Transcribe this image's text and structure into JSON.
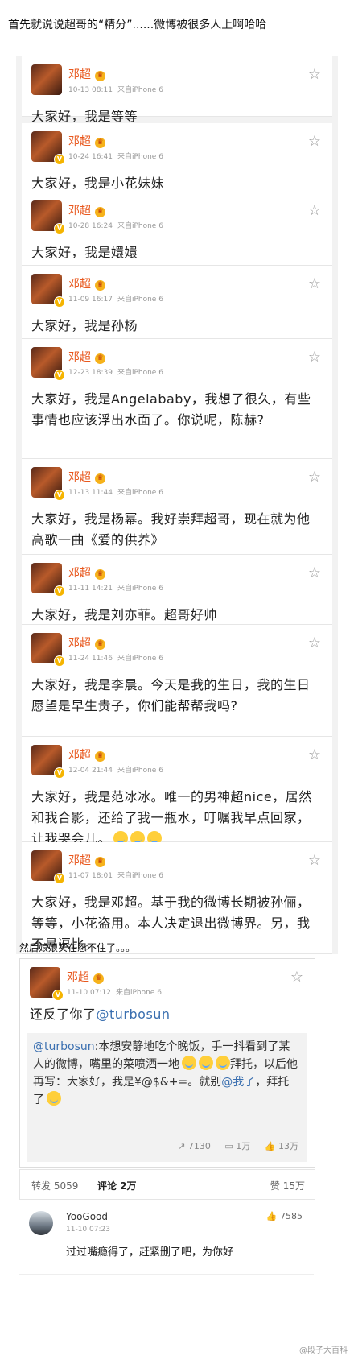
{
  "caption": "首先就说说超哥的“精分”......微博被很多人上啊哈哈",
  "posts": [
    {
      "name": "邓超",
      "date": "10-13 08:11",
      "source": "来自iPhone 6",
      "text": "大家好，我是等等"
    },
    {
      "name": "邓超",
      "date": "10-24 16:41",
      "source": "来自iPhone 6",
      "text": "大家好，我是小花妹妹"
    },
    {
      "name": "邓超",
      "date": "10-28 16:24",
      "source": "来自iPhone 6",
      "text": "大家好，我是嬛嬛"
    },
    {
      "name": "邓超",
      "date": "11-09 16:17",
      "source": "来自iPhone 6",
      "text": "大家好，我是孙杨"
    },
    {
      "name": "邓超",
      "date": "12-23 18:39",
      "source": "来自iPhone 6",
      "text": "大家好，我是Angelababy，我想了很久，有些事情也应该浮出水面了。你说呢，陈赫?"
    },
    {
      "name": "邓超",
      "date": "11-13 11:44",
      "source": "来自iPhone 6",
      "text": "大家好，我是杨幂。我好崇拜超哥，现在就为他高歌一曲《爱的供养》"
    },
    {
      "name": "邓超",
      "date": "11-11 14:21",
      "source": "来自iPhone 6",
      "text": "大家好，我是刘亦菲。超哥好帅"
    },
    {
      "name": "邓超",
      "date": "11-24 11:46",
      "source": "来自iPhone 6",
      "text": "大家好，我是李晨。今天是我的生日，我的生日愿望是早生贵子，你们能帮帮我吗?"
    },
    {
      "name": "邓超",
      "date": "12-04 21:44",
      "source": "来自iPhone 6",
      "text": "大家好，我是范冰冰。唯一的男神超nice，居然和我合影，还给了我一瓶水，叮嘱我早点回家，让我哭会儿。"
    },
    {
      "name": "邓超",
      "date": "11-07 18:01",
      "source": "来自iPhone 6",
      "text": "大家好，我是邓超。基于我的微博长期被孙俪，等等，小花盗用。本人决定退出微博界。另，我不是逗比。"
    }
  ],
  "section2_label": "然后娘娘实在忍不住了。。。",
  "repost": {
    "name": "邓超",
    "date": "11-10 07:12",
    "source": "来自iPhone 6",
    "text_prefix": "还反了你了",
    "mention": "@turbosun",
    "quote_mention": "@turbosun",
    "quote_text": ":本想安静地吃个晚饭，手一抖看到了某人的微博，嘴里的菜喷洒一地",
    "quote_text2": "拜托，以后他再写：大家好，我是¥@$&+=。就别",
    "quote_mention2": "@我了",
    "quote_text3": "，拜托了",
    "repost_count": "7130",
    "comment_count": "1万",
    "like_count": "13万"
  },
  "stats": {
    "reposts": "转发 5059",
    "comments": "评论 2万",
    "likes": "赞 15万"
  },
  "comment": {
    "name": "YooGood",
    "date": "11-10 07:23",
    "likes": "7585",
    "text": "过过嘴瘾得了，赶紧删了吧，为你好"
  },
  "watermark": "@段子大百科"
}
